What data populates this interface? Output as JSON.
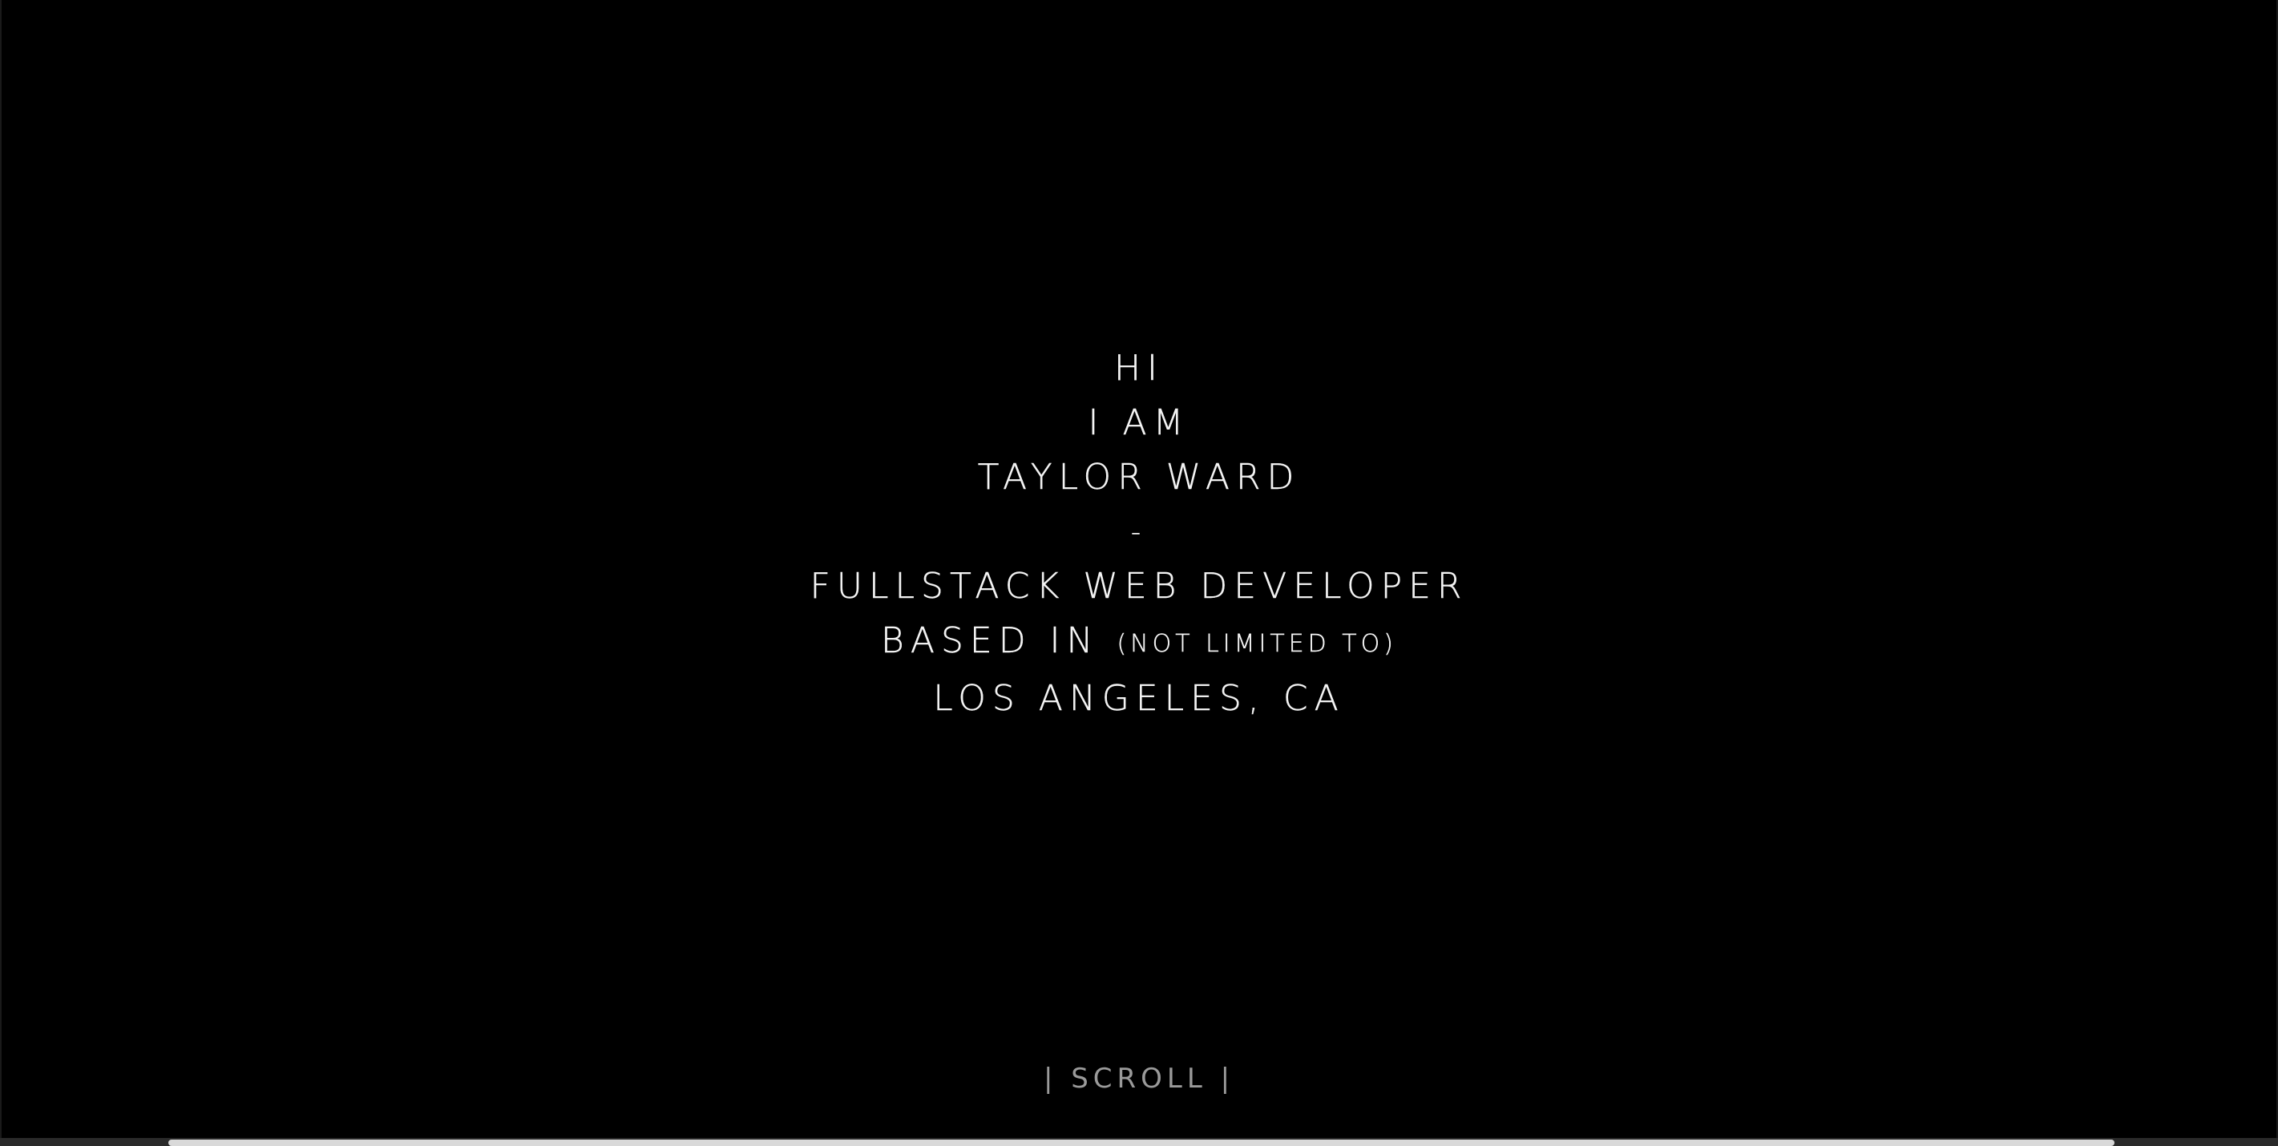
{
  "hero": {
    "greeting": "HI",
    "i_am": "I AM",
    "name": "TAYLOR WARD",
    "separator": "-",
    "role": "FULLSTACK WEB DEVELOPER",
    "based_in": "BASED IN",
    "not_limited": "(NOT LIMITED TO)",
    "location": "LOS ANGELES, CA"
  },
  "scroll": {
    "label": "| SCROLL |"
  },
  "colors": {
    "background": "#000000",
    "text": "#f4f4f4",
    "scroll_text": "#9a9a9a"
  }
}
